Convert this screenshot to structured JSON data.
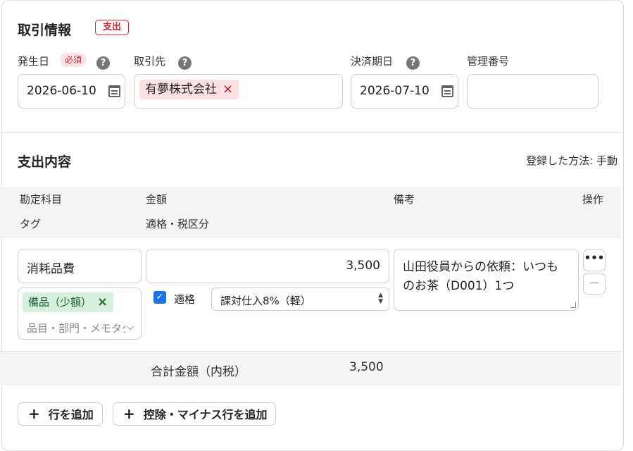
{
  "transaction": {
    "title": "取引情報",
    "type_badge": "支出",
    "fields": {
      "occurred_date": {
        "label": "発生日",
        "required_badge": "必須",
        "value": "2026-06-10"
      },
      "partner": {
        "label": "取引先",
        "chip": "有夢株式会社",
        "remove_icon": "×"
      },
      "due_date": {
        "label": "決済期日",
        "value": "2026-07-10"
      },
      "management_no": {
        "label": "管理番号",
        "value": ""
      }
    },
    "help_icon": "?"
  },
  "expense": {
    "title": "支出内容",
    "registration_method": "登録した方法: 手動",
    "columns": {
      "account": "勘定科目",
      "amount": "金額",
      "memo": "備考",
      "actions": "操作",
      "tag": "タグ",
      "qualified_tax": "適格・税区分"
    },
    "row": {
      "account": "消耗品費",
      "amount": "3,500",
      "tag_chip": "備品（少額）",
      "tag_remove": "×",
      "tag_placeholder": "品目・部門・メモタグ",
      "qualified_label": "適格",
      "qualified_checked": true,
      "tax_category": "課対仕入8%（軽）",
      "memo": "山田役員からの依頼：いつものお茶（D001）1つ",
      "more_icon": "•••",
      "remove_row_icon": "−"
    },
    "total": {
      "label": "合計金額（内税）",
      "value": "3,500"
    },
    "buttons": {
      "add_row": "行を追加",
      "add_deduction_row": "控除・マイナス行を追加",
      "plus_icon": "+"
    }
  },
  "colors": {
    "accent_red": "#d0242e",
    "tag_green": "#d7efdd",
    "checkbox_blue": "#1a73e8"
  }
}
